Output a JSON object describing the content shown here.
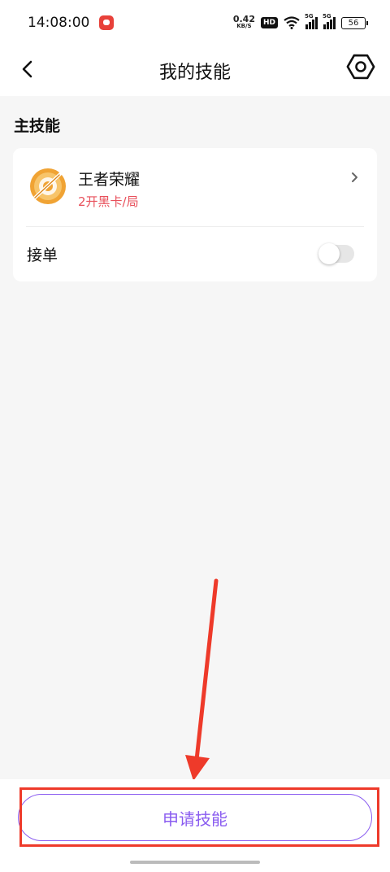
{
  "status_bar": {
    "time": "14:08:00",
    "net_speed_value": "0.42",
    "net_speed_unit": "KB/S",
    "hd_badge": "HD",
    "signal1_label": "5G",
    "signal2_label": "5G",
    "battery": "56"
  },
  "app_bar": {
    "title": "我的技能",
    "back_icon": "chevron-left-icon",
    "settings_icon": "hexagon-settings-icon"
  },
  "section": {
    "title": "主技能"
  },
  "skill": {
    "name": "王者荣耀",
    "price": "2开黑卡/局",
    "icon": "game-logo-icon"
  },
  "accept": {
    "label": "接单",
    "enabled": false
  },
  "apply_button": {
    "label": "申请技能"
  },
  "colors": {
    "accent": "#8a5cf0",
    "price": "#e8505b",
    "annotation": "#ee3a2a"
  }
}
